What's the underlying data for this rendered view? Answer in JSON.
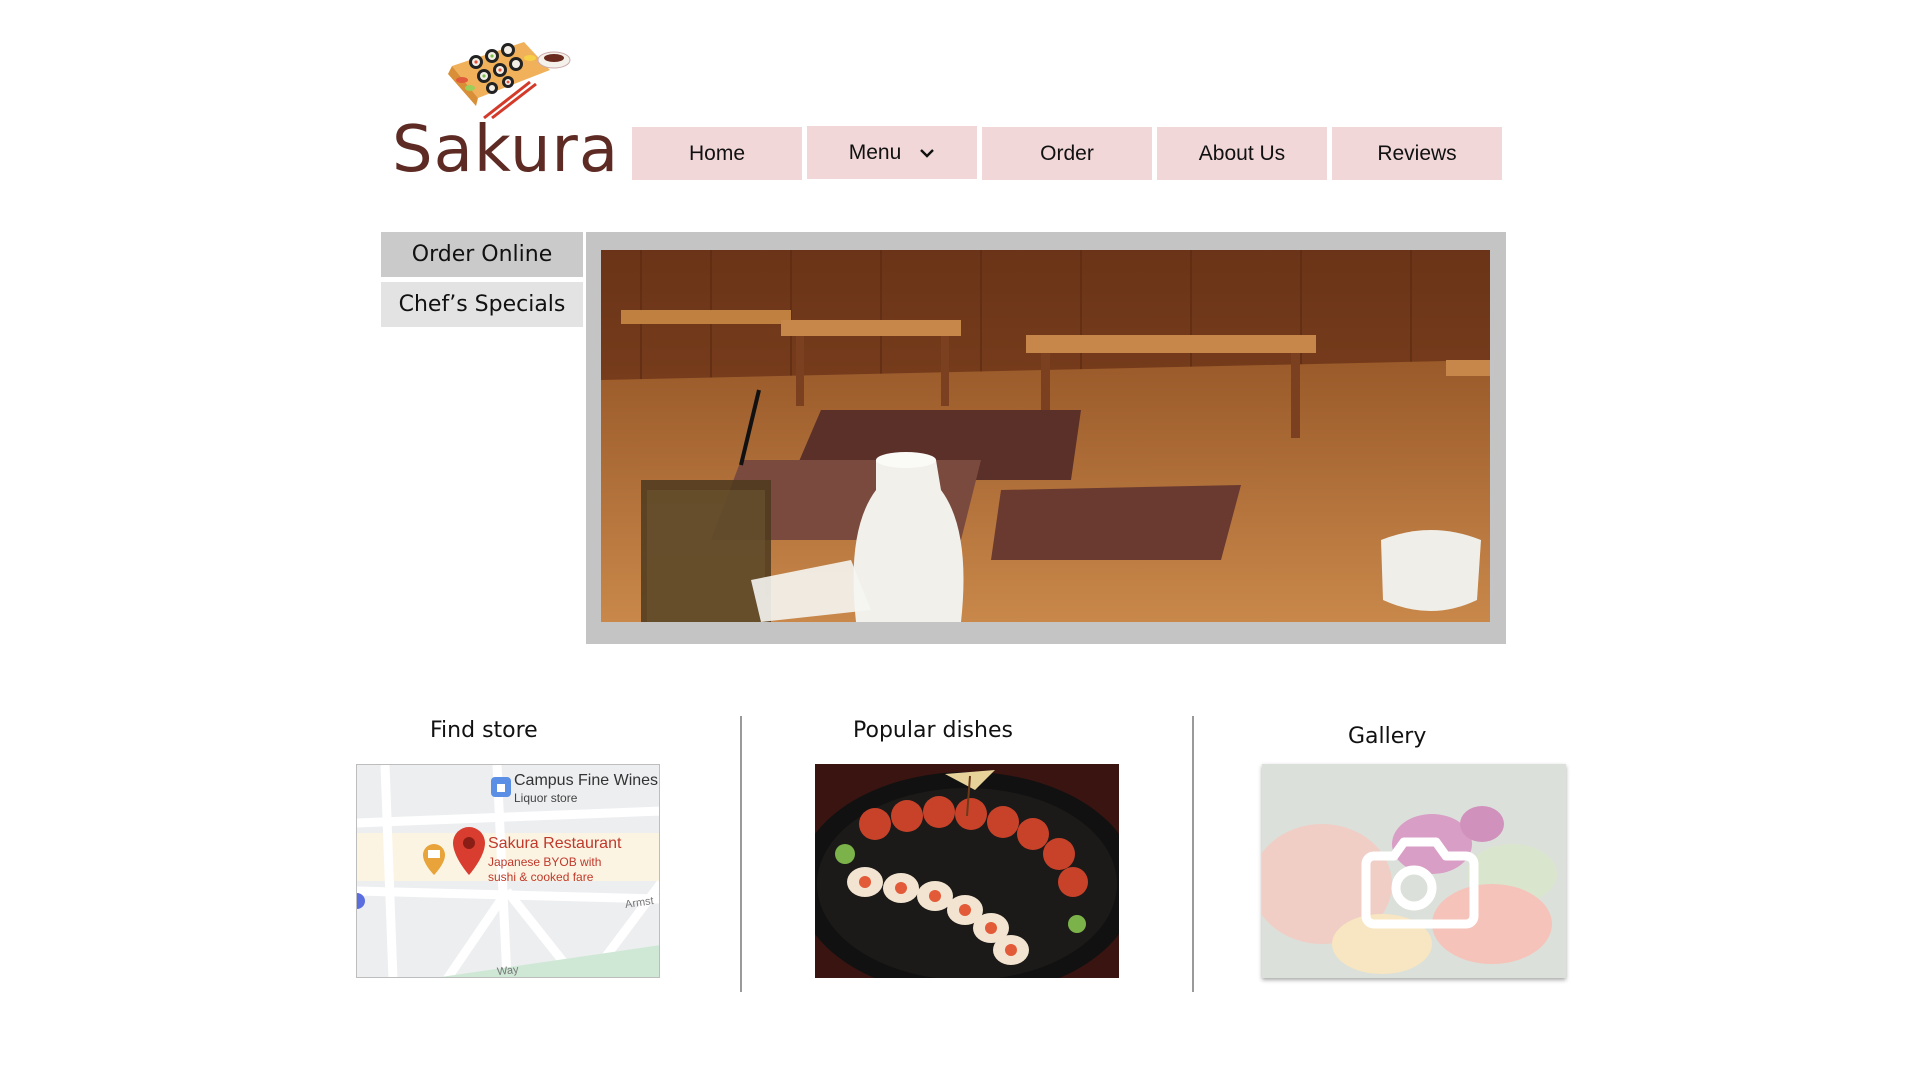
{
  "brand": {
    "name": "Sakura",
    "color": "#5e2b24",
    "logo_icon": "sushi-platter-icon"
  },
  "nav": {
    "items": [
      {
        "label": "Home"
      },
      {
        "label": "Menu",
        "has_dropdown": true
      },
      {
        "label": "Order"
      },
      {
        "label": "About Us"
      },
      {
        "label": "Reviews"
      }
    ],
    "bg_color": "#f1d7d8"
  },
  "side_menu": {
    "items": [
      {
        "label": "Order Online",
        "bg": "#cacaca"
      },
      {
        "label": "Chef’s Specials",
        "bg": "#e3e3e3"
      }
    ]
  },
  "hero": {
    "frame_color": "#c4c4c4"
  },
  "sections": [
    {
      "title": "Find store"
    },
    {
      "title": "Popular dishes"
    },
    {
      "title": "Gallery"
    }
  ],
  "map": {
    "poi_liquor_name": "Campus Fine Wines",
    "poi_liquor_type": "Liquor store",
    "poi_restaurant_name": "Sakura Restaurant",
    "poi_restaurant_desc_1": "Japanese BYOB with",
    "poi_restaurant_desc_2": "sushi & cooked fare",
    "street_1": "Armst",
    "street_2": "Way"
  },
  "gallery": {
    "icon": "camera-icon"
  }
}
